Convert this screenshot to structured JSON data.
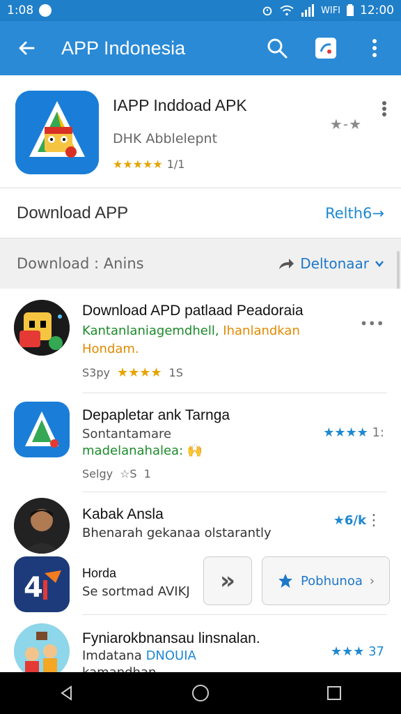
{
  "status": {
    "time_left": "1:08",
    "time_right": "12:00",
    "signal_text": "WIFI"
  },
  "appbar": {
    "title": "APP Indonesia",
    "back_icon": "arrow-left-icon",
    "search_icon": "search-icon",
    "share_icon": "share-icon",
    "more_icon": "more-vert-icon"
  },
  "hero": {
    "name": "IAPP Inddoad APK",
    "developer": "DHK Abblelepnt",
    "rating_text": "★★★★★",
    "rating_count": "1/1",
    "mini_rating": "★-★"
  },
  "download": {
    "label": "Download APP",
    "link": "Relth6→"
  },
  "filter": {
    "label": "Download : Anins",
    "sort": "Deltonaar"
  },
  "items": [
    {
      "title": "Download APD patlaad Peadoraia",
      "subtitle_green": "Kantanlaniagemdhell,",
      "subtitle_orange": " Ihanlandkan",
      "subtitle2": "Hondam.",
      "meta_left": "S3py",
      "meta_stars": "★★★★",
      "meta_right": "1S",
      "action": "•••"
    },
    {
      "title": "Depapletar ank Tarnga",
      "subtitle": "Sontantamare",
      "subtitle_green": "madelanahalea:",
      "meta_left": "Selgy",
      "meta_mid": "☆S",
      "meta_right": "1",
      "right_rating": "★★★★",
      "right_rating2": "1:"
    },
    {
      "title": "Kabak Ansla",
      "subtitle": "Bhenarah gekanaa olstarantly",
      "right_rating": "★6/k",
      "action": "⋮"
    },
    {
      "title": "Horda",
      "subtitle": "Se sortmad AVIKJ",
      "btn_arrow": "»",
      "btn_label": "Pobhunoa",
      "btn_icon": "star-icon"
    },
    {
      "title": "Fyniarokbnansau linsnalan.",
      "subtitle": "Imdatana",
      "subtitle_blue": "DNOUIA",
      "subtitle2": "kamandhan",
      "right_rating": "★★★",
      "right_count": "37"
    }
  ],
  "navbar": {
    "back": "back-icon",
    "home": "home-icon",
    "recent": "recent-icon"
  },
  "colors": {
    "primary": "#2a8ad6",
    "status": "#1f7fc9",
    "accent": "#1e88d2",
    "star": "#e6a400"
  }
}
